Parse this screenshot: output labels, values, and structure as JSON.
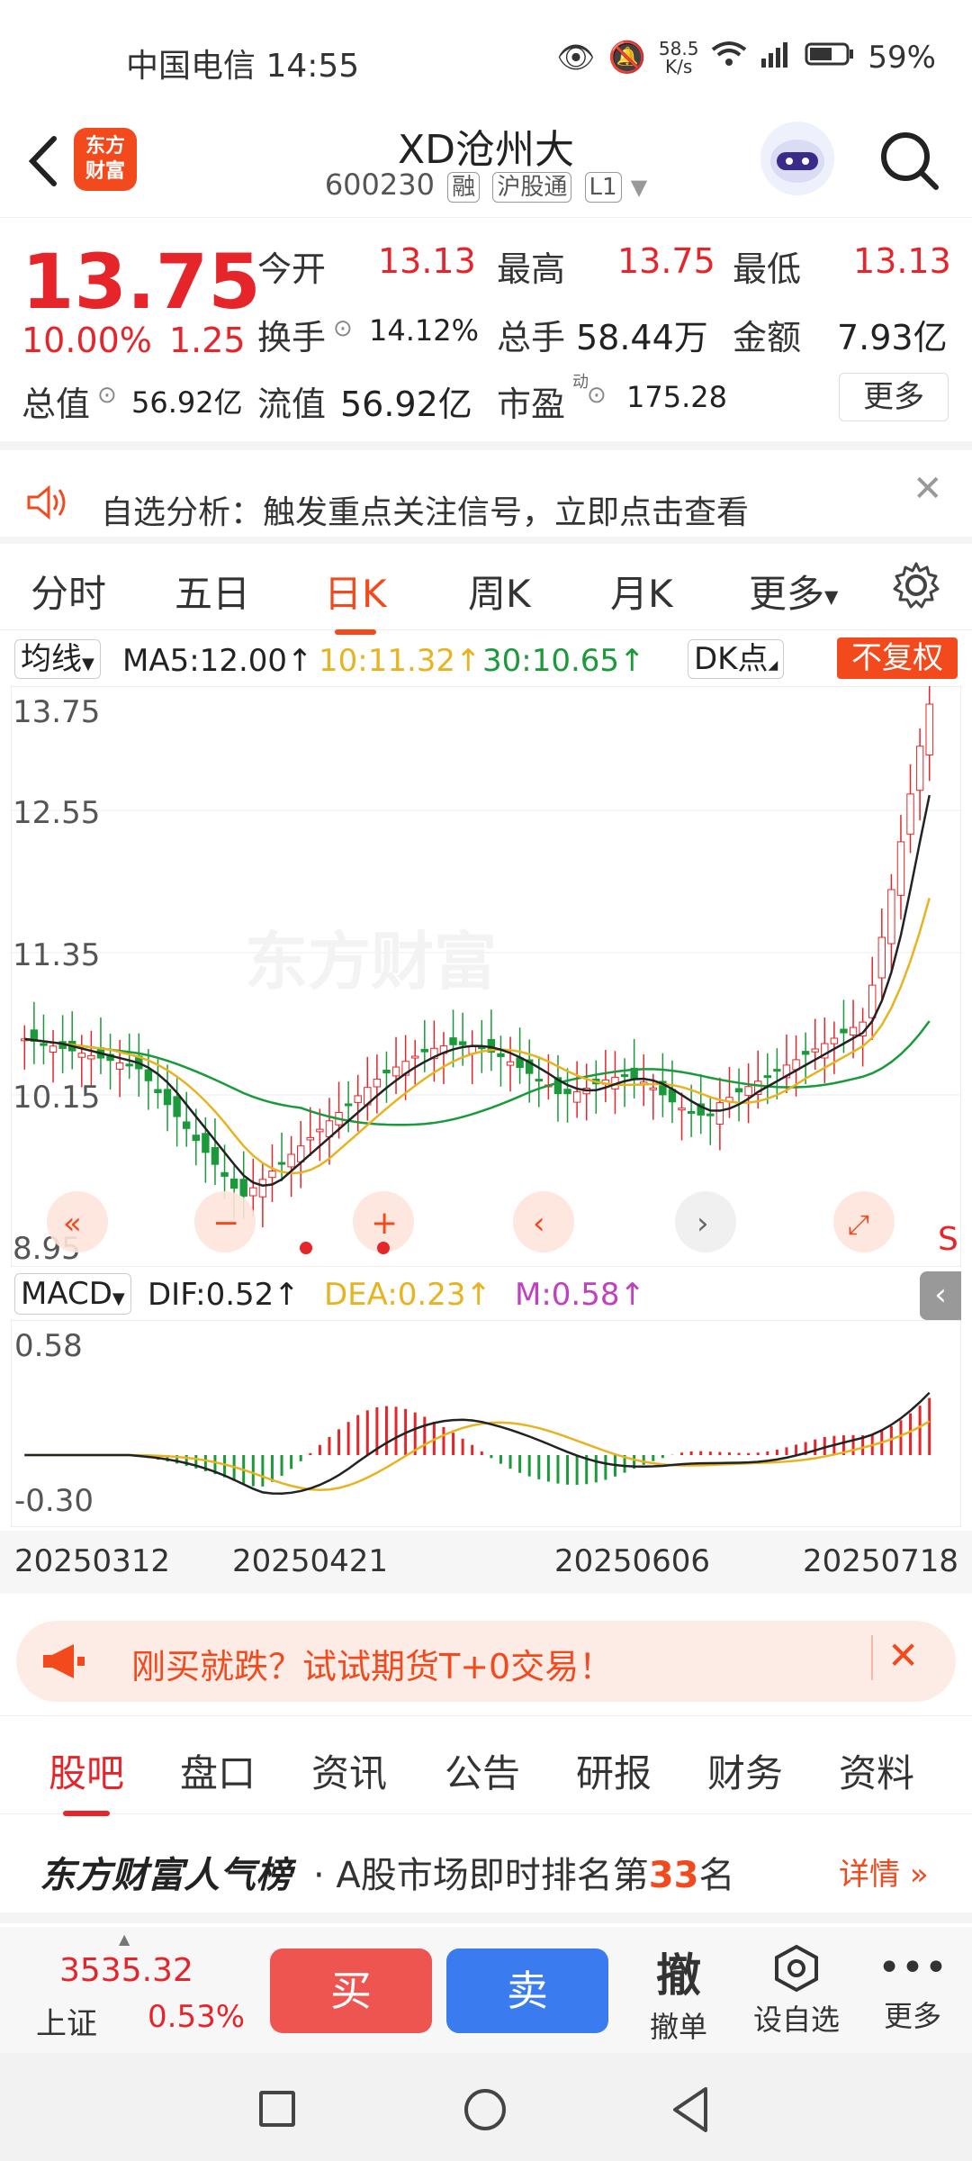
{
  "status": {
    "time": "中国电信 14:55",
    "net_speed_top": "58.5",
    "net_speed_bottom": "K/s",
    "battery": "59%"
  },
  "header": {
    "title": "XD沧州大",
    "code": "600230",
    "tags": [
      "融",
      "沪股通",
      "L1"
    ],
    "logo_top": "东方",
    "logo_bottom": "财富"
  },
  "quote": {
    "price": "13.75",
    "change_pct": "10.00%",
    "change": "1.25",
    "open_label": "今开",
    "open": "13.13",
    "high_label": "最高",
    "high": "13.75",
    "low_label": "最低",
    "low": "13.13",
    "turnover_label": "换手",
    "turnover": "14.12%",
    "volume_label": "总手",
    "volume": "58.44万",
    "amount_label": "金额",
    "amount": "7.93亿",
    "mktcap_label": "总值",
    "mktcap": "56.92亿",
    "float_label": "流值",
    "float": "56.92亿",
    "pe_label": "市盈",
    "pe_sup": "动",
    "pe": "175.28",
    "more": "更多"
  },
  "notice": {
    "text": "自选分析：触发重点关注信号，立即点击查看"
  },
  "tabs": {
    "items": [
      "分时",
      "五日",
      "日K",
      "周K",
      "月K",
      "更多"
    ],
    "active": "日K"
  },
  "ma_row": {
    "selector": "均线",
    "ma5": "MA5:12.00",
    "ma10": "10:11.32",
    "ma30": "30:10.65",
    "dk": "DK点",
    "fq": "不复权"
  },
  "kchart": {
    "y_labels": [
      "13.75",
      "12.55",
      "11.35",
      "10.15",
      "8.95"
    ],
    "watermark": "东方财富",
    "s_marker": "S"
  },
  "macd_row": {
    "selector": "MACD",
    "dif": "DIF:0.52",
    "dea": "DEA:0.23",
    "m": "M:0.58"
  },
  "macd": {
    "y_top": "0.58",
    "y_bottom": "-0.30"
  },
  "dates": [
    "20250312",
    "20250421",
    "20250606",
    "20250718"
  ],
  "banner": {
    "text": "刚买就跌？试试期货T+0交易！"
  },
  "bottom_tabs": {
    "items": [
      "股吧",
      "盘口",
      "资讯",
      "公告",
      "研报",
      "财务",
      "资料"
    ],
    "active": "股吧"
  },
  "rank": {
    "brand": "东方财富人气榜",
    "text_pre": "· A股市场即时排名第",
    "rank": "33",
    "text_post": "名",
    "detail": "详情"
  },
  "trade": {
    "index_value": "3535.32",
    "index_name": "上证",
    "index_change": "0.53%",
    "buy": "买",
    "sell": "卖",
    "cancel_glyph": "撤",
    "cancel": "撤单",
    "watch": "设自选",
    "more": "更多"
  },
  "colors": {
    "up": "#e5252a",
    "down": "#1a9a3a",
    "accent": "#f24a1d",
    "sell_blue": "#3a7cf0",
    "ma5": "#222222",
    "ma10": "#e8b321",
    "ma30": "#1a9a3a"
  }
}
